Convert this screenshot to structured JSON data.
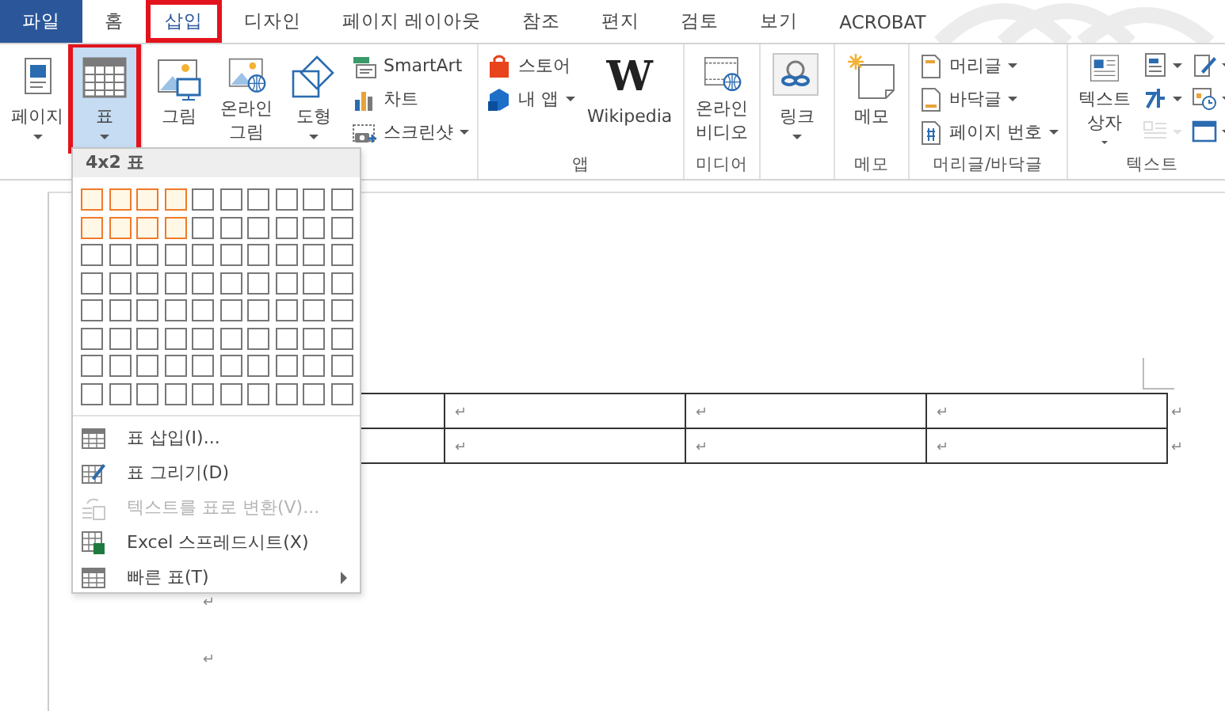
{
  "tabs": [
    {
      "label": "파일",
      "kind": "file",
      "selected": false,
      "annotated": false
    },
    {
      "label": "홈",
      "kind": "tab",
      "selected": false,
      "annotated": false
    },
    {
      "label": "삽입",
      "kind": "tab",
      "selected": true,
      "annotated": true
    },
    {
      "label": "디자인",
      "kind": "tab",
      "selected": false,
      "annotated": false
    },
    {
      "label": "페이지 레이아웃",
      "kind": "tab",
      "selected": false,
      "annotated": false
    },
    {
      "label": "참조",
      "kind": "tab",
      "selected": false,
      "annotated": false
    },
    {
      "label": "편지",
      "kind": "tab",
      "selected": false,
      "annotated": false
    },
    {
      "label": "검토",
      "kind": "tab",
      "selected": false,
      "annotated": false
    },
    {
      "label": "보기",
      "kind": "tab",
      "selected": false,
      "annotated": false
    },
    {
      "label": "ACROBAT",
      "kind": "tab",
      "selected": false,
      "annotated": false
    }
  ],
  "ribbon": {
    "groups": [
      {
        "items": [
          {
            "kind": "large",
            "label": "페이지",
            "dropdown": true,
            "pressed": false,
            "annotated": false
          },
          {
            "kind": "large",
            "label": "표",
            "dropdown": true,
            "pressed": true,
            "annotated": true
          }
        ]
      },
      {
        "items": [
          {
            "kind": "large",
            "label": "그림",
            "dropdown": false,
            "pressed": false,
            "annotated": false
          },
          {
            "kind": "large",
            "label": "온라인\n그림",
            "dropdown": false,
            "pressed": false,
            "annotated": false
          },
          {
            "kind": "large",
            "label": "도형",
            "dropdown": true,
            "pressed": false,
            "annotated": false
          },
          {
            "kind": "stack",
            "entries": [
              {
                "label": "SmartArt",
                "dropdown": false
              },
              {
                "label": "차트",
                "dropdown": false
              },
              {
                "label": "스크린샷",
                "dropdown": true
              }
            ]
          }
        ]
      },
      {
        "label": "앱",
        "items": [
          {
            "kind": "stack",
            "entries": [
              {
                "label": "스토어",
                "dropdown": false
              },
              {
                "label": "내 앱",
                "dropdown": true
              }
            ]
          },
          {
            "kind": "logo",
            "glyph": "W",
            "label": "Wikipedia"
          }
        ]
      },
      {
        "label": "미디어",
        "items": [
          {
            "kind": "large",
            "label": "온라인\n비디오",
            "dropdown": false,
            "pressed": false,
            "annotated": false
          }
        ]
      },
      {
        "items": [
          {
            "kind": "large",
            "label": "링크",
            "dropdown": true,
            "pressed": false,
            "annotated": false
          }
        ]
      },
      {
        "label": "메모",
        "items": [
          {
            "kind": "large",
            "label": "메모",
            "dropdown": false,
            "pressed": false,
            "annotated": false
          }
        ]
      },
      {
        "label": "머리글/바닥글",
        "items": [
          {
            "kind": "stack",
            "entries": [
              {
                "label": "머리글",
                "dropdown": true
              },
              {
                "label": "바닥글",
                "dropdown": true
              },
              {
                "label": "페이지 번호",
                "dropdown": true
              }
            ]
          }
        ]
      },
      {
        "label": "텍스트",
        "items": [
          {
            "kind": "large",
            "label": "텍스트\n상자",
            "dropdown": true,
            "pressed": false,
            "annotated": false
          },
          {
            "kind": "icongrid",
            "cells": [
              {
                "disabled": false
              },
              {
                "disabled": false
              },
              {
                "disabled": false
              },
              {
                "disabled": false
              },
              {
                "disabled": true
              },
              {
                "disabled": false
              }
            ]
          }
        ]
      }
    ]
  },
  "table_menu": {
    "header": "4x2 표",
    "grid": [
      [
        true,
        true,
        true,
        true,
        false,
        false,
        false,
        false,
        false,
        false
      ],
      [
        true,
        true,
        true,
        true,
        false,
        false,
        false,
        false,
        false,
        false
      ],
      [
        false,
        false,
        false,
        false,
        false,
        false,
        false,
        false,
        false,
        false
      ],
      [
        false,
        false,
        false,
        false,
        false,
        false,
        false,
        false,
        false,
        false
      ],
      [
        false,
        false,
        false,
        false,
        false,
        false,
        false,
        false,
        false,
        false
      ],
      [
        false,
        false,
        false,
        false,
        false,
        false,
        false,
        false,
        false,
        false
      ],
      [
        false,
        false,
        false,
        false,
        false,
        false,
        false,
        false,
        false,
        false
      ],
      [
        false,
        false,
        false,
        false,
        false,
        false,
        false,
        false,
        false,
        false
      ]
    ],
    "items": [
      {
        "label": "표 삽입(I)...",
        "disabled": false,
        "submenu": false
      },
      {
        "label": "표 그리기(D)",
        "disabled": false,
        "submenu": false
      },
      {
        "label": "텍스트를 표로 변환(V)...",
        "disabled": true,
        "submenu": false
      },
      {
        "label": "Excel 스프레드시트(X)",
        "disabled": false,
        "submenu": false
      },
      {
        "label": "빠른 표(T)",
        "disabled": false,
        "submenu": true
      }
    ]
  },
  "document": {
    "table": {
      "rows": [
        {
          "cells": [
            "",
            "↵",
            "↵",
            "↵"
          ],
          "end": "↵"
        },
        {
          "cells": [
            "",
            "↵",
            "↵",
            "↵"
          ],
          "end": "↵"
        }
      ]
    },
    "paragraphs": [
      "↵",
      "↵"
    ]
  }
}
